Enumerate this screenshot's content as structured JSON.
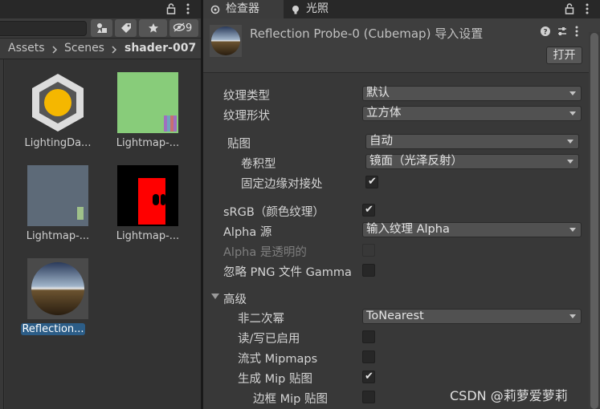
{
  "left": {
    "toolbar": {
      "hidden_count": "9"
    },
    "breadcrumb": [
      "Assets",
      "Scenes",
      "shader-007"
    ],
    "assets": [
      {
        "name": "LightingDa..."
      },
      {
        "name": "Lightmap-..."
      },
      {
        "name": "Lightmap-..."
      },
      {
        "name": "Lightmap-..."
      },
      {
        "name": "Reflection..."
      }
    ]
  },
  "right": {
    "tabs": [
      {
        "label": "检查器",
        "icon": "inspector-icon"
      },
      {
        "label": "光照",
        "icon": "light-bulb-icon"
      }
    ],
    "header": {
      "title": "Reflection Probe-0 (Cubemap) 导入设置",
      "open_label": "打开"
    },
    "fields": {
      "texture_type": {
        "label": "纹理类型",
        "value": "默认"
      },
      "texture_shape": {
        "label": "纹理形状",
        "value": "立方体"
      },
      "mapping": {
        "label": "贴图",
        "value": "自动"
      },
      "convolution": {
        "label": "卷积型",
        "value": "镜面（光泽反射）"
      },
      "fixup_edge": {
        "label": "固定边缘对接处",
        "checked": true
      },
      "srgb": {
        "label": "sRGB（颜色纹理）",
        "checked": true
      },
      "alpha_source": {
        "label": "Alpha 源",
        "value": "输入纹理 Alpha"
      },
      "alpha_is_transparency": {
        "label": "Alpha 是透明的",
        "checked": false
      },
      "ignore_png_gamma": {
        "label": "忽略 PNG 文件 Gamma",
        "checked": false
      },
      "advanced": {
        "label": "高级"
      },
      "npot": {
        "label": "非二次幂",
        "value": "ToNearest"
      },
      "read_write": {
        "label": "读/写已启用",
        "checked": false
      },
      "streaming_mipmaps": {
        "label": "流式 Mipmaps",
        "checked": false
      },
      "generate_mip": {
        "label": "生成 Mip 贴图",
        "checked": true
      },
      "border_mip": {
        "label": "边框 Mip 贴图",
        "checked": false
      }
    }
  },
  "watermark": "CSDN @莉萝爱萝莉",
  "colors": {
    "accent_selection": "#2c5d87",
    "panel_bg": "#383838"
  }
}
